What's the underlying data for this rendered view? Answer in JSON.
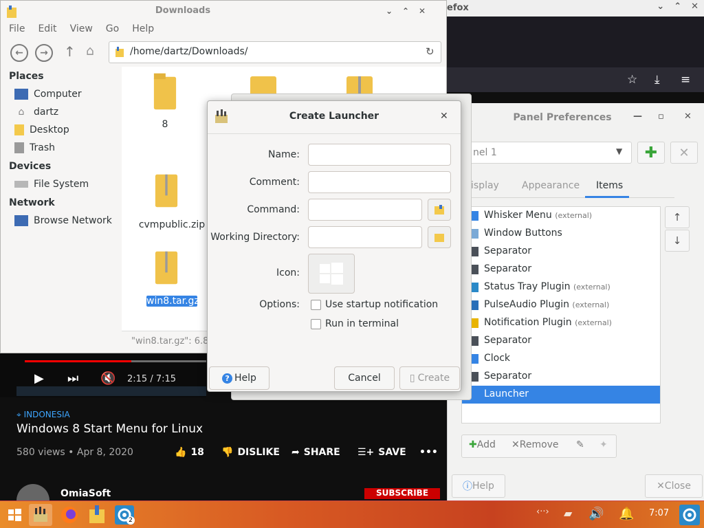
{
  "firefox": {
    "title_fragment": "efox",
    "ctl_min": "⌄",
    "ctl_max": "⌃",
    "ctl_close": "✕"
  },
  "youtube": {
    "time": "2:15 / 7:15",
    "progress_fraction": 0.31,
    "location": "INDONESIA",
    "title": "Windows 8 Start Menu for Linux",
    "meta": "580 views • Apr 8, 2020",
    "like_count": "18",
    "dislike_label": "DISLIKE",
    "share_label": "SHARE",
    "save_label": "SAVE",
    "more": "•••",
    "channel": "OmiaSoft",
    "subscribe": "SUBSCRIBE"
  },
  "file_manager": {
    "title": "Downloads",
    "menu": [
      "File",
      "Edit",
      "View",
      "Go",
      "Help"
    ],
    "path": "/home/dartz/Downloads/",
    "places_header": "Places",
    "places": [
      "Computer",
      "dartz",
      "Desktop",
      "Trash"
    ],
    "devices_header": "Devices",
    "devices": [
      "File System"
    ],
    "network_header": "Network",
    "network": [
      "Browse Network"
    ],
    "files": [
      "8",
      "cvmpublic.zip",
      "win8.tar.gz"
    ],
    "status": "\"win8.tar.gz\": 6.8"
  },
  "launcher_dialog": {
    "title": "Create Launcher",
    "name_label": "Name:",
    "comment_label": "Comment:",
    "command_label": "Command:",
    "workdir_label": "Working Directory:",
    "icon_label": "Icon:",
    "options_label": "Options:",
    "opt_startup": "Use startup notification",
    "opt_terminal": "Run in terminal",
    "help": "Help",
    "cancel": "Cancel",
    "create": "Create"
  },
  "panel_prefs": {
    "title": "Panel Preferences",
    "panel_combo": "nel 1",
    "tabs": [
      "isplay",
      "Appearance",
      "Items"
    ],
    "items": [
      {
        "name": "Whisker Menu",
        "ext": "(external)"
      },
      {
        "name": "Window Buttons",
        "ext": ""
      },
      {
        "name": "Separator",
        "ext": ""
      },
      {
        "name": "Separator",
        "ext": ""
      },
      {
        "name": "Status Tray Plugin",
        "ext": "(external)"
      },
      {
        "name": "PulseAudio Plugin",
        "ext": "(external)"
      },
      {
        "name": "Notification Plugin",
        "ext": "(external)"
      },
      {
        "name": "Separator",
        "ext": ""
      },
      {
        "name": "Clock",
        "ext": ""
      },
      {
        "name": "Separator",
        "ext": ""
      },
      {
        "name": "Launcher",
        "ext": ""
      }
    ],
    "add": "Add",
    "remove": "Remove",
    "help": "Help",
    "close": "Close"
  },
  "taskbar": {
    "clock": "7:07",
    "badge": "2"
  },
  "colors": {
    "accent": "#3584e4",
    "youtube_red": "#ff0000",
    "folder": "#f3c94b"
  }
}
